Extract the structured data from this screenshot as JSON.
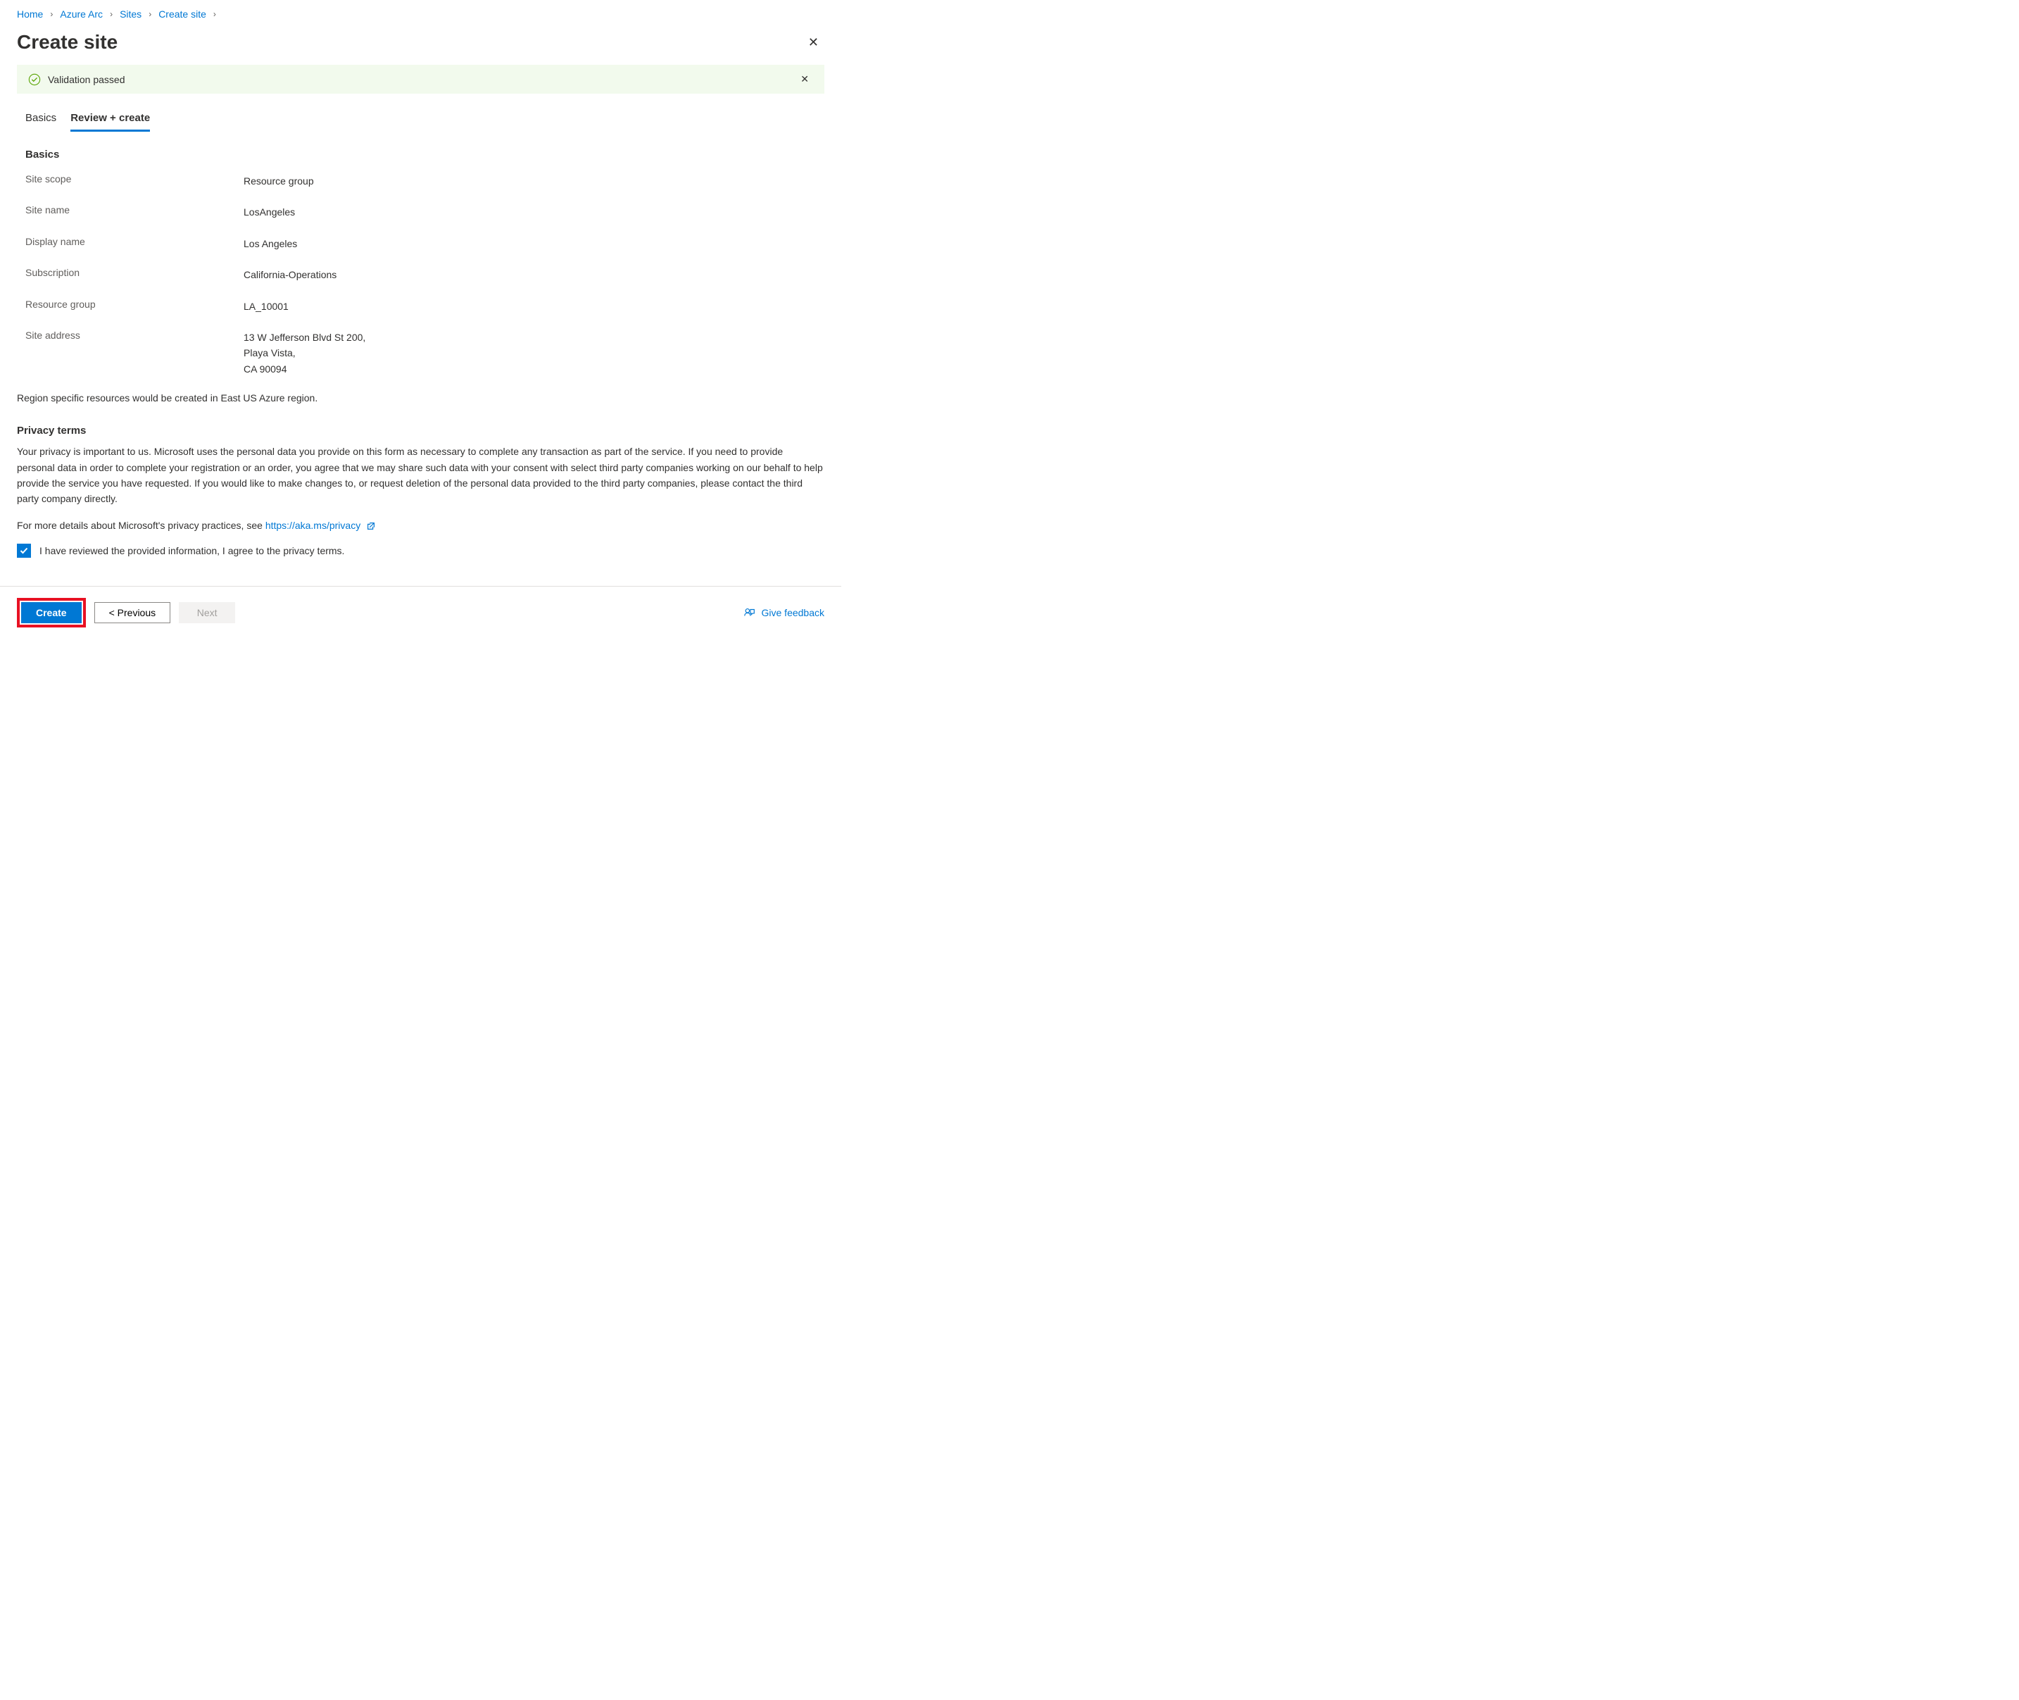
{
  "breadcrumb": {
    "items": [
      "Home",
      "Azure Arc",
      "Sites",
      "Create site"
    ]
  },
  "page": {
    "title": "Create site"
  },
  "validation": {
    "message": "Validation passed"
  },
  "tabs": {
    "basics": "Basics",
    "review": "Review + create"
  },
  "basics": {
    "section_title": "Basics",
    "site_scope_label": "Site scope",
    "site_scope_value": "Resource group",
    "site_name_label": "Site name",
    "site_name_value": "LosAngeles",
    "display_name_label": "Display name",
    "display_name_value": "Los Angeles",
    "subscription_label": "Subscription",
    "subscription_value": "California-Operations",
    "resource_group_label": "Resource group",
    "resource_group_value": "LA_10001",
    "site_address_label": "Site address",
    "site_address_value": "13 W Jefferson Blvd St 200,\nPlaya Vista,\nCA 90094"
  },
  "region_note": "Region specific resources would be created in East US Azure region.",
  "privacy": {
    "title": "Privacy terms",
    "body": "Your privacy is important to us. Microsoft uses the personal data you provide on this form as necessary to complete any transaction as part of the service. If you need to provide personal data in order to complete your registration or an order, you agree that we may share such data with your consent with select third party companies working on our behalf to help provide the service you have requested. If you would like to make changes to, or request deletion of the personal data provided to the third party companies, please contact the third party company directly.",
    "link_prefix": "For more details about Microsoft's privacy practices, see ",
    "link_text": "https://aka.ms/privacy",
    "checkbox_label": "I have reviewed the provided information, I agree to the privacy terms."
  },
  "footer": {
    "create": "Create",
    "previous": "< Previous",
    "next": "Next",
    "feedback": "Give feedback"
  }
}
